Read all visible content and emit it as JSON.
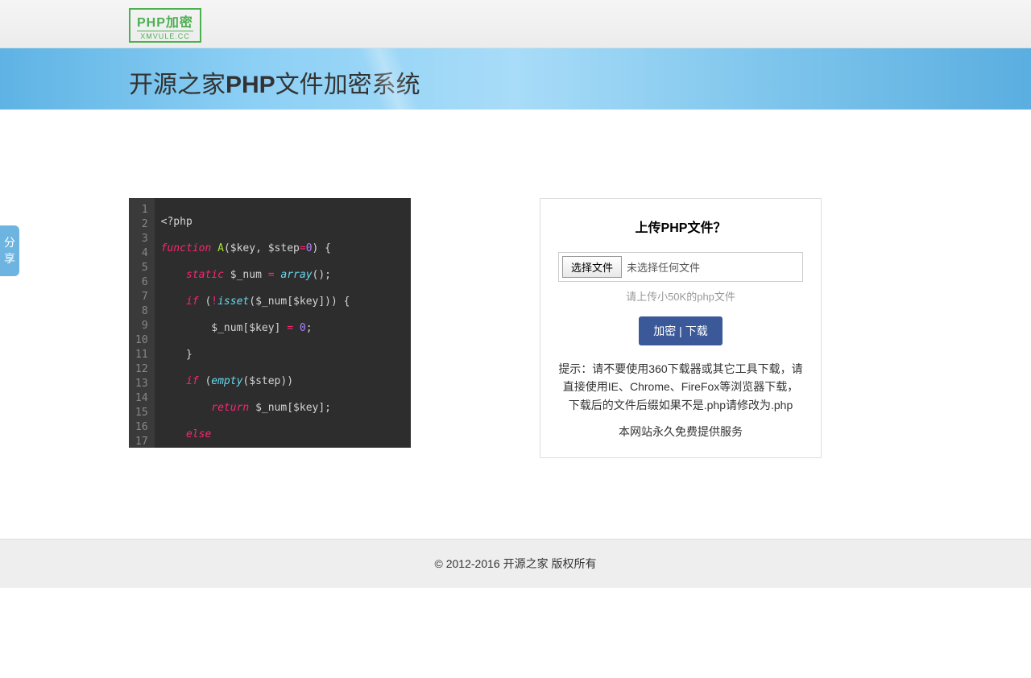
{
  "logo": {
    "main": "PHP加密",
    "sub": "XMVULE.CC"
  },
  "hero": {
    "prefix": "开源之家",
    "bold": "PHP",
    "suffix": "文件加密系统"
  },
  "code": {
    "lines": [
      1,
      2,
      3,
      4,
      5,
      6,
      7,
      8,
      9,
      10,
      11,
      12,
      13,
      14,
      15,
      16,
      17
    ]
  },
  "upload": {
    "title": "上传PHP文件？",
    "choose_btn": "选择文件",
    "no_file": "未选择任何文件",
    "hint": "请上传小50K的php文件",
    "submit": "加密 | 下载",
    "tip": "提示：请不要使用360下载器或其它工具下载，请直接使用IE、Chrome、FireFox等浏览器下载，下载后的文件后缀如果不是.php请修改为.php",
    "free": "本网站永久免费提供服务"
  },
  "footer": "© 2012-2016 开源之家 版权所有",
  "share": {
    "c1": "分",
    "c2": "享"
  }
}
